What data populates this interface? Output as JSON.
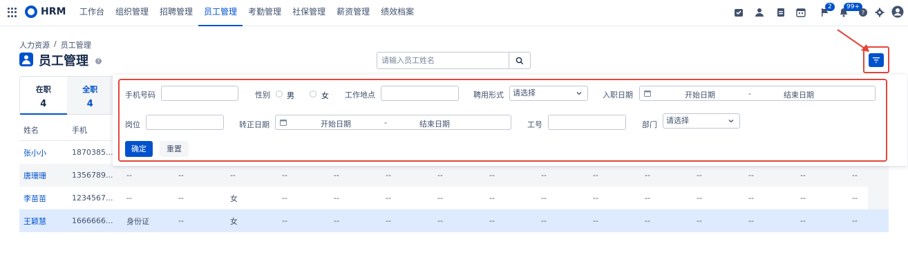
{
  "app": {
    "name": "HRM"
  },
  "nav": [
    "工作台",
    "组织管理",
    "招聘管理",
    "员工管理",
    "考勤管理",
    "社保管理",
    "薪资管理",
    "绩效档案"
  ],
  "topbar": {
    "flag_badge": "2",
    "bell_badge": "99+"
  },
  "breadcrumb": {
    "root": "人力资源",
    "sep": "/",
    "current": "员工管理"
  },
  "page": {
    "title": "员工管理",
    "help": "?"
  },
  "search": {
    "placeholder": "请输入员工姓名"
  },
  "status_tabs": [
    {
      "label": "在职",
      "count": "4"
    },
    {
      "label": "全职",
      "count": "4"
    }
  ],
  "filter": {
    "phone_label": "手机号码",
    "gender_label": "性别",
    "gender_male": "男",
    "gender_female": "女",
    "workplace_label": "工作地点",
    "employment_label": "聘用形式",
    "employment_placeholder": "请选择",
    "hire_date_label": "入职日期",
    "hire_date_start": "开始日期",
    "hire_date_sep": "-",
    "hire_date_end": "结束日期",
    "post_label": "岗位",
    "regular_date_label": "转正日期",
    "regular_date_start": "开始日期",
    "regular_date_sep": "-",
    "regular_date_end": "结束日期",
    "job_no_label": "工号",
    "dept_label": "部门",
    "dept_placeholder": "请选择",
    "confirm": "确定",
    "reset": "重置"
  },
  "table": {
    "headers": [
      "姓名",
      "手机"
    ],
    "rows": [
      {
        "name": "张小小",
        "phone": "1870385...",
        "cells": []
      },
      {
        "name": "唐珊珊",
        "phone": "1356789...",
        "cells": [
          "--",
          "--",
          "--",
          "--",
          "--",
          "--",
          "--",
          "--",
          "--",
          "--",
          "--",
          "--",
          "--",
          "--",
          "--"
        ]
      },
      {
        "name": "李苗苗",
        "phone": "1234567...",
        "cells": [
          "--",
          "--",
          "女",
          "--",
          "--",
          "--",
          "--",
          "--",
          "--",
          "--",
          "--",
          "--",
          "--",
          "--",
          "--"
        ]
      },
      {
        "name": "王颖慧",
        "phone": "1666666...",
        "cells": [
          "身份证",
          "--",
          "女",
          "--",
          "--",
          "--",
          "--",
          "--",
          "--",
          "--",
          "--",
          "--",
          "--",
          "--",
          "--"
        ]
      }
    ]
  },
  "colors": {
    "primary": "#0052cc",
    "highlight": "#e2463a",
    "selected_row": "#deebff"
  }
}
